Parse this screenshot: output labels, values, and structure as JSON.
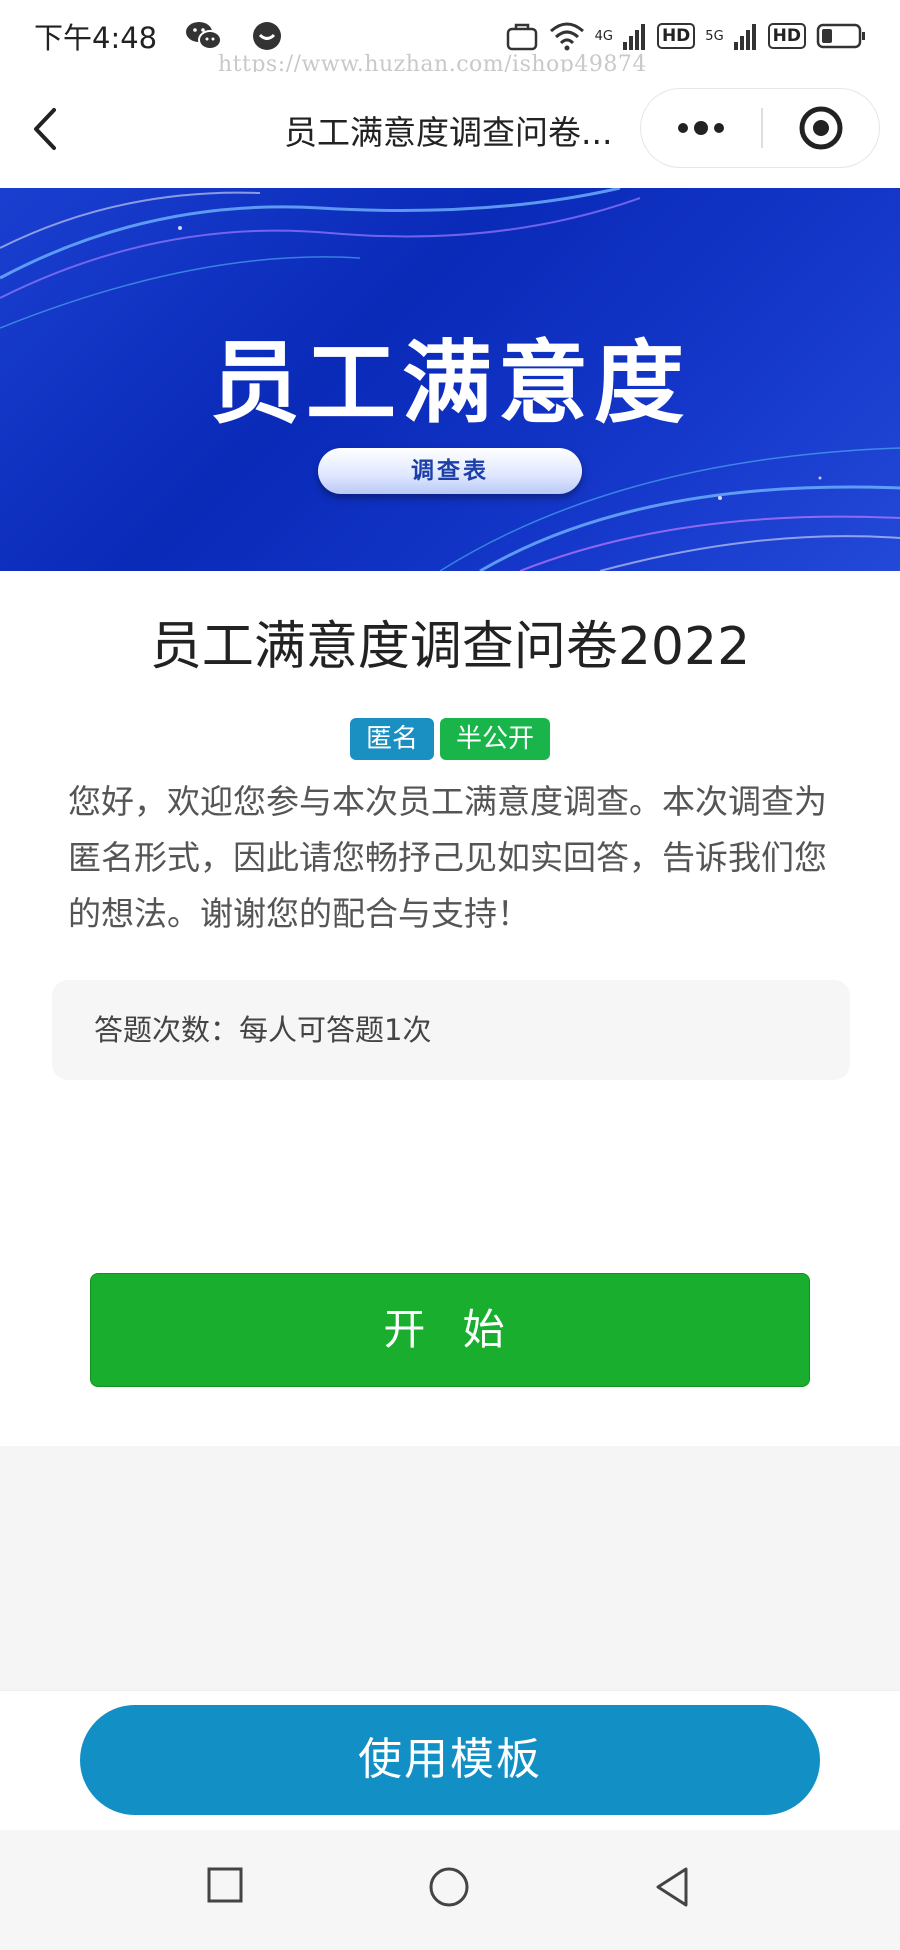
{
  "status_bar": {
    "time": "下午4:48",
    "network_4g": "4G",
    "network_5g": "5G",
    "hd_1": "HD",
    "hd_2": "HD"
  },
  "watermark": "https://www.huzhan.com/ishop49874",
  "nav": {
    "title": "员工满意度调查问卷..."
  },
  "banner": {
    "title": "员工满意度",
    "subtitle": "调查表"
  },
  "survey": {
    "title": "员工满意度调查问卷2022",
    "tags": [
      "匿名",
      "半公开"
    ],
    "intro": "您好，欢迎您参与本次员工满意度调查。本次调查为匿名形式，因此请您畅抒己见如实回答，告诉我们您的想法。谢谢您的配合与支持！",
    "answer_limit": "答题次数：每人可答题1次",
    "start_label": "开 始"
  },
  "footer": {
    "use_template_label": "使用模板"
  },
  "colors": {
    "start_button": "#19ae2e",
    "template_button": "#1290c6",
    "tag_anonymous": "#1a8fc2",
    "tag_semi_public": "#19b44a",
    "banner_blue": "#0a2ab8"
  }
}
